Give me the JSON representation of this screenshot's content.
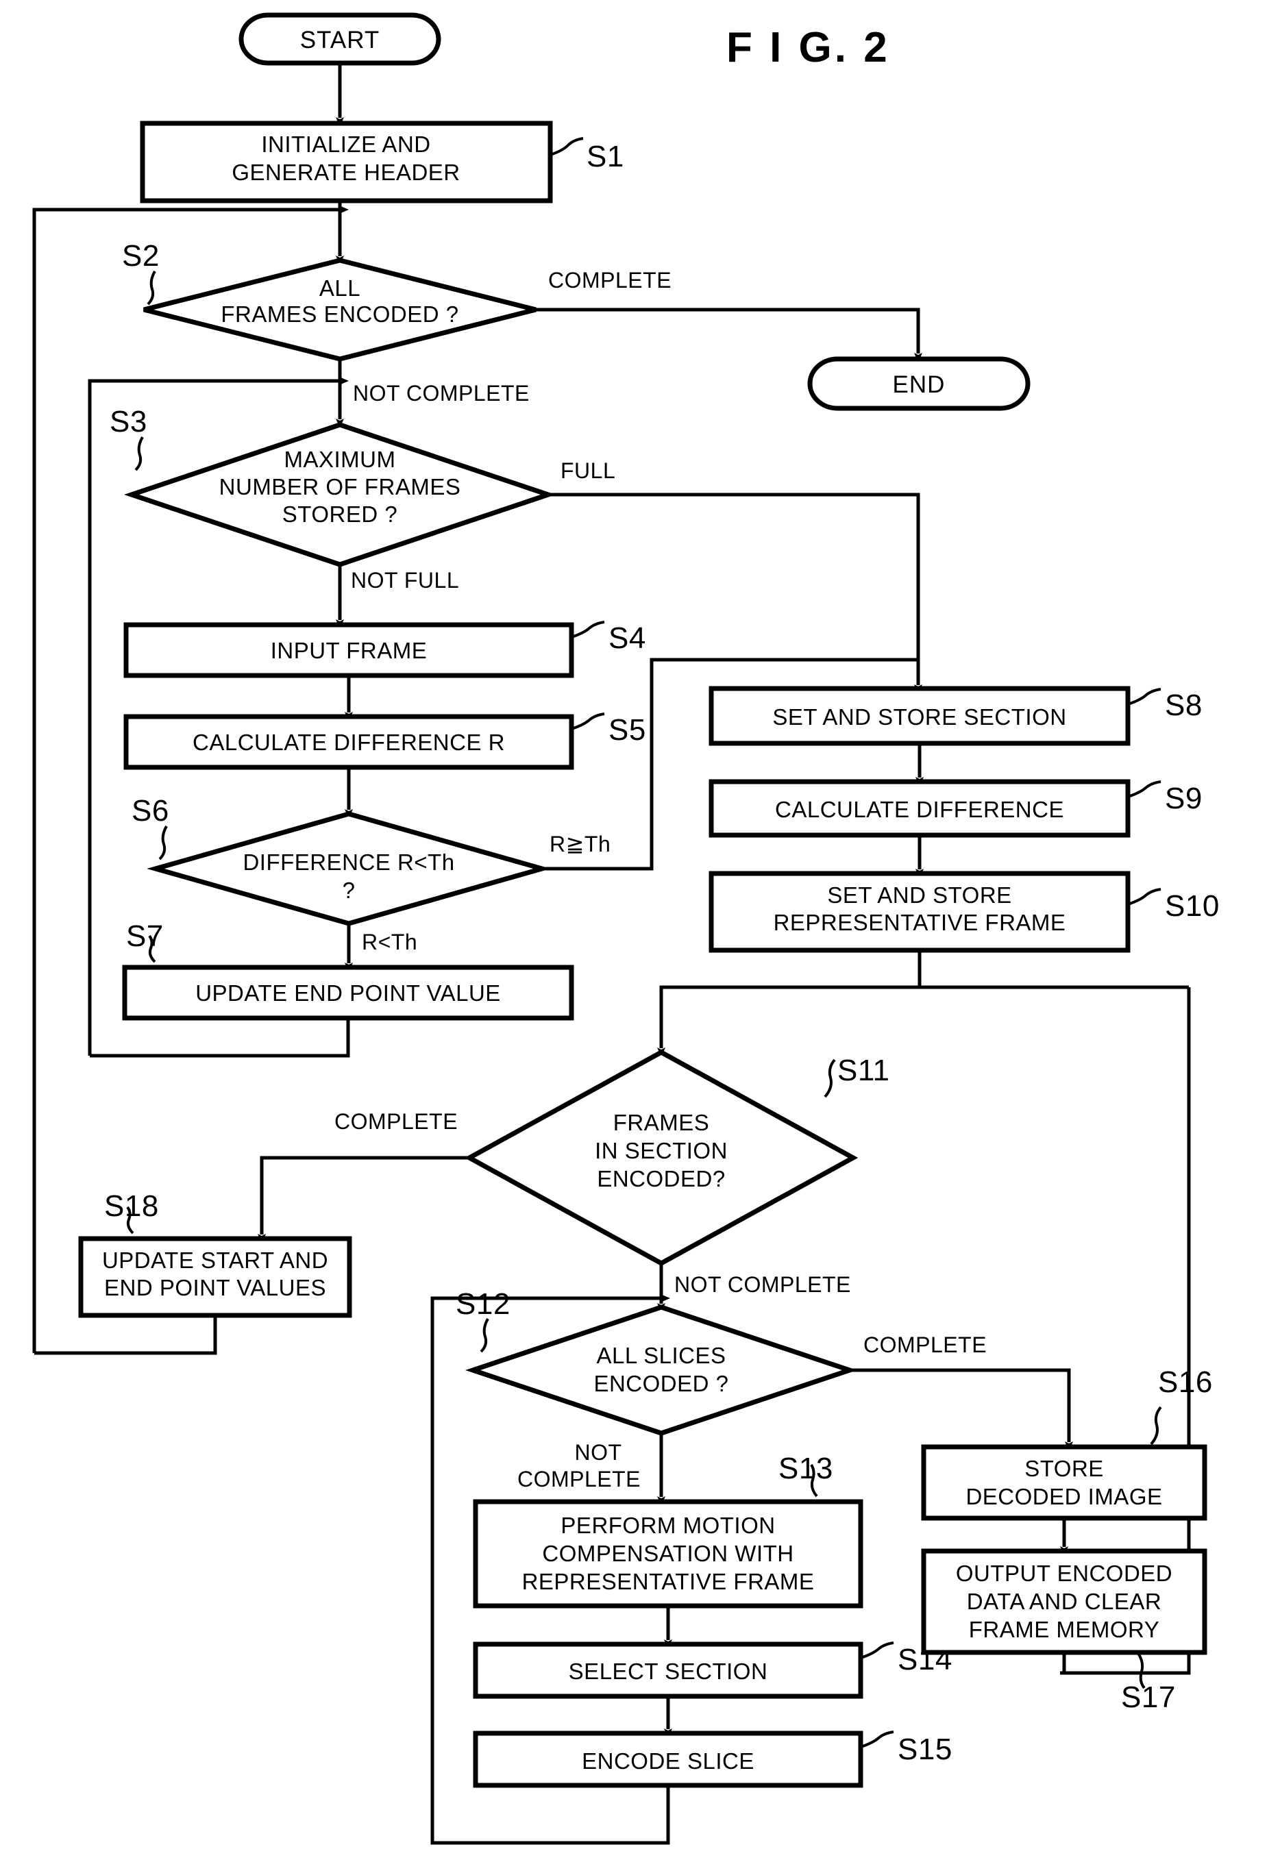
{
  "figure": {
    "title": "F I G.  2",
    "type": "patent-flowchart",
    "background_color": "#ffffff",
    "line_color": "#000000"
  },
  "terminators": {
    "start": "START",
    "end": "END"
  },
  "steps": [
    {
      "id": "S1",
      "label": "S1",
      "kind": "process",
      "lines": [
        "INITIALIZE AND",
        "GENERATE HEADER"
      ]
    },
    {
      "id": "S2",
      "label": "S2",
      "kind": "decision",
      "lines": [
        "ALL",
        "FRAMES ENCODED ?"
      ]
    },
    {
      "id": "S3",
      "label": "S3",
      "kind": "decision",
      "lines": [
        "MAXIMUM",
        "NUMBER OF FRAMES",
        "STORED ?"
      ]
    },
    {
      "id": "S4",
      "label": "S4",
      "kind": "process",
      "lines": [
        "INPUT FRAME"
      ]
    },
    {
      "id": "S5",
      "label": "S5",
      "kind": "process",
      "lines": [
        "CALCULATE DIFFERENCE R"
      ]
    },
    {
      "id": "S6",
      "label": "S6",
      "kind": "decision",
      "lines": [
        "DIFFERENCE R<Th",
        "?"
      ]
    },
    {
      "id": "S7",
      "label": "S7",
      "kind": "process",
      "lines": [
        "UPDATE END POINT VALUE"
      ]
    },
    {
      "id": "S8",
      "label": "S8",
      "kind": "process",
      "lines": [
        "SET AND STORE SECTION"
      ]
    },
    {
      "id": "S9",
      "label": "S9",
      "kind": "process",
      "lines": [
        "CALCULATE DIFFERENCE"
      ]
    },
    {
      "id": "S10",
      "label": "S10",
      "kind": "process",
      "lines": [
        "SET AND STORE",
        "REPRESENTATIVE FRAME"
      ]
    },
    {
      "id": "S11",
      "label": "S11",
      "kind": "decision",
      "lines": [
        "FRAMES",
        "IN SECTION",
        "ENCODED?"
      ]
    },
    {
      "id": "S12",
      "label": "S12",
      "kind": "decision",
      "lines": [
        "ALL SLICES",
        "ENCODED ?"
      ]
    },
    {
      "id": "S13",
      "label": "S13",
      "kind": "process",
      "lines": [
        "PERFORM MOTION",
        "COMPENSATION WITH",
        "REPRESENTATIVE FRAME"
      ]
    },
    {
      "id": "S14",
      "label": "S14",
      "kind": "process",
      "lines": [
        "SELECT SECTION"
      ]
    },
    {
      "id": "S15",
      "label": "S15",
      "kind": "process",
      "lines": [
        "ENCODE SLICE"
      ]
    },
    {
      "id": "S16",
      "label": "S16",
      "kind": "process",
      "lines": [
        "STORE",
        "DECODED IMAGE"
      ]
    },
    {
      "id": "S17",
      "label": "S17",
      "kind": "process",
      "lines": [
        "OUTPUT ENCODED",
        "DATA AND CLEAR",
        "FRAME MEMORY"
      ]
    },
    {
      "id": "S18",
      "label": "S18",
      "kind": "process",
      "lines": [
        "UPDATE START AND",
        "END POINT VALUES"
      ]
    }
  ],
  "edge_labels": {
    "s2_complete": "COMPLETE",
    "s2_not_complete": "NOT COMPLETE",
    "s3_full": "FULL",
    "s3_not_full": "NOT FULL",
    "s6_ge_th": "R≧Th",
    "s6_lt_th": "R<Th",
    "s11_complete": "COMPLETE",
    "s11_not_complete": "NOT COMPLETE",
    "s12_complete": "COMPLETE",
    "s12_not_line1": "NOT",
    "s12_not_line2": "COMPLETE"
  }
}
